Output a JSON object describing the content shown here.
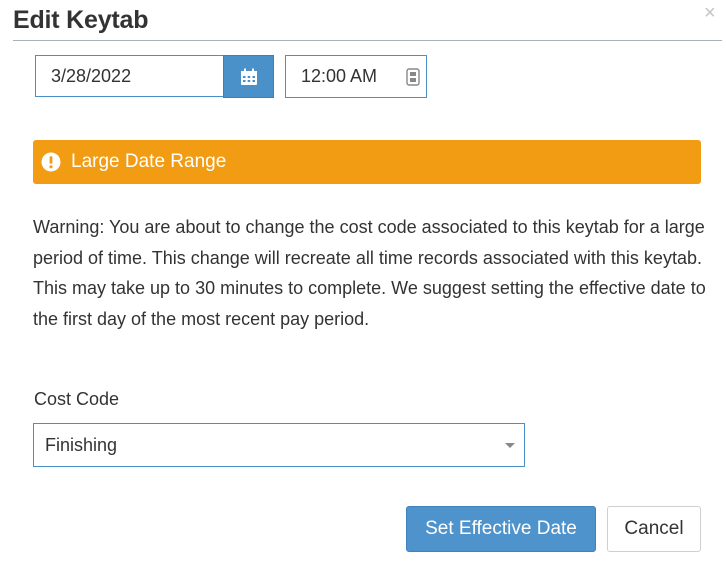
{
  "dialog": {
    "title": "Edit Keytab",
    "close_symbol": "×"
  },
  "effective": {
    "date_value": "3/28/2022",
    "time_value": "12:00 AM"
  },
  "alert": {
    "title": "Large Date Range",
    "color": "#f19c13",
    "icon": "exclamation-circle-icon"
  },
  "warning": {
    "text": "Warning: You are about to change the cost code associated to this keytab for a large period of time. This change will recreate all time records associated with this keytab. This may take up to 30 minutes to complete. We suggest setting the effective date to the first day of the most recent pay period."
  },
  "cost_code": {
    "label": "Cost Code",
    "selected": "Finishing"
  },
  "actions": {
    "primary_label": "Set Effective Date",
    "cancel_label": "Cancel",
    "primary_color": "#4f93cc"
  },
  "icons": {
    "calendar": "calendar-icon",
    "time": "clock-picker-icon",
    "close": "close-icon",
    "dropdown": "chevron-down-icon"
  }
}
